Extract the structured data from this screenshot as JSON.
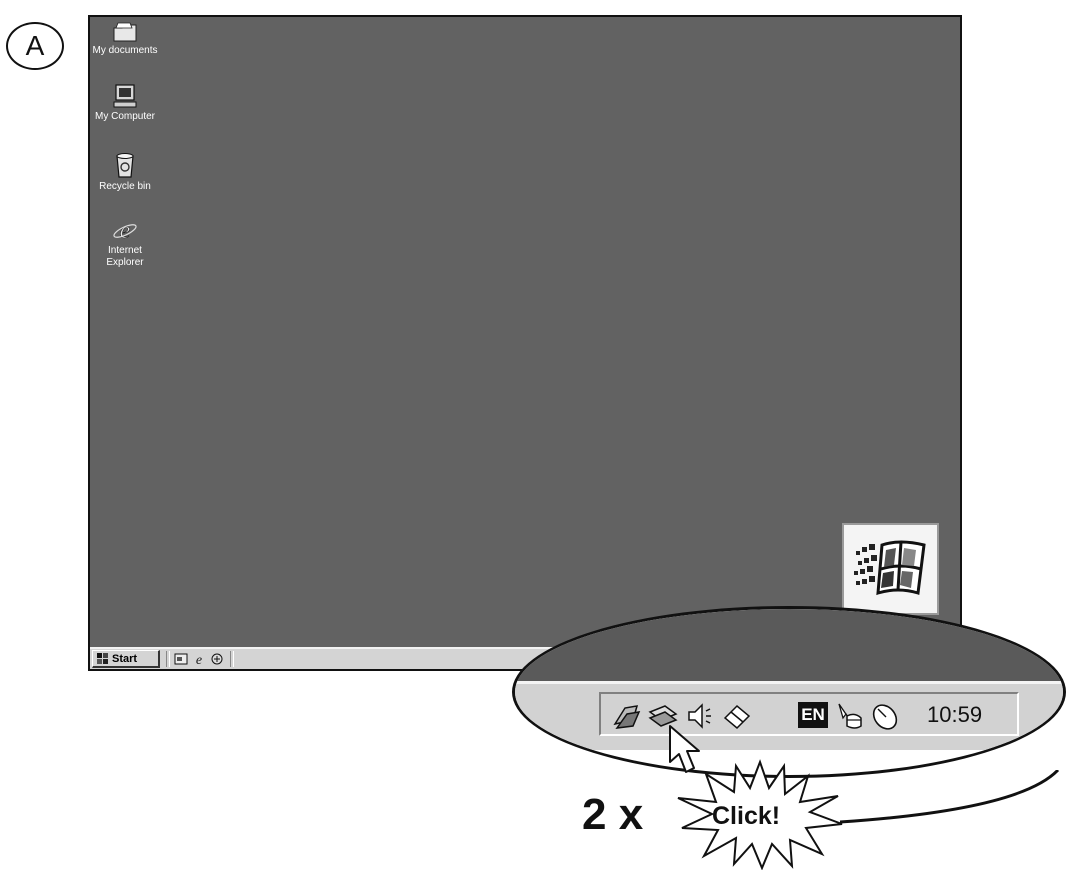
{
  "step_label": "A",
  "desktop": {
    "icons": [
      {
        "label": "My documents",
        "icon": "folder-icon"
      },
      {
        "label": "My Computer",
        "icon": "computer-icon"
      },
      {
        "label": "Recycle bin",
        "icon": "recycle-bin-icon"
      },
      {
        "label": "Internet Explorer",
        "icon": "internet-explorer-icon"
      }
    ],
    "background_color": "#626262"
  },
  "taskbar": {
    "start_label": "Start",
    "quick_launch": [
      "show-desktop-icon",
      "internet-explorer-icon",
      "outlook-icon"
    ]
  },
  "zoom": {
    "tray_icons": [
      "network-icon",
      "pc-card-icon",
      "volume-icon",
      "eraser-icon",
      "language-icon",
      "mouse-settings-icon",
      "mouse-icon"
    ],
    "language": "EN",
    "clock": "10:59"
  },
  "annotation": {
    "times": "2 x",
    "click": "Click!"
  }
}
